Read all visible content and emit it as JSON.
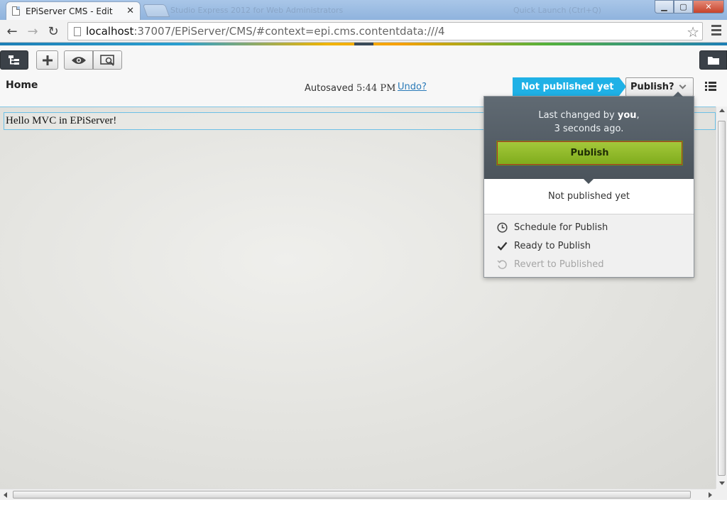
{
  "browser": {
    "tab_title": "EPiServer CMS - Edit",
    "tab_close": "✕",
    "ghost_text_1": "Studio Express 2012 for Web Administrators",
    "ghost_text_2": "Quick Launch (Ctrl+Q)",
    "url_host": "localhost",
    "url_path": ":37007/EPiServer/CMS/#context=epi.cms.contentdata:///4",
    "back": "←",
    "forward": "→",
    "reload": "↻",
    "bookmark": "☆",
    "win_min": "▁",
    "win_max": "▢",
    "win_close": "✕"
  },
  "cms": {
    "page_title": "Home",
    "autosave_label": "Autosaved",
    "autosave_time": "5:44 PM",
    "undo_label": "Undo?",
    "status_label": "Not published yet",
    "publish_menu_label": "Publish?",
    "colors": {
      "status": "#1fb1e6",
      "publish_button": "#8fba27"
    }
  },
  "content": {
    "text": "Hello MVC in EPiServer!"
  },
  "publish_panel": {
    "last_changed_prefix": "Last changed by",
    "last_changed_user": "you",
    "last_changed_suffix": ",",
    "last_changed_when": "3 seconds ago.",
    "publish_button": "Publish",
    "status_text": "Not published yet",
    "items": [
      {
        "label": "Schedule for Publish",
        "icon": "clock-icon",
        "enabled": true
      },
      {
        "label": "Ready to Publish",
        "icon": "check-icon",
        "enabled": true
      },
      {
        "label": "Revert to Published",
        "icon": "revert-icon",
        "enabled": false
      }
    ]
  }
}
